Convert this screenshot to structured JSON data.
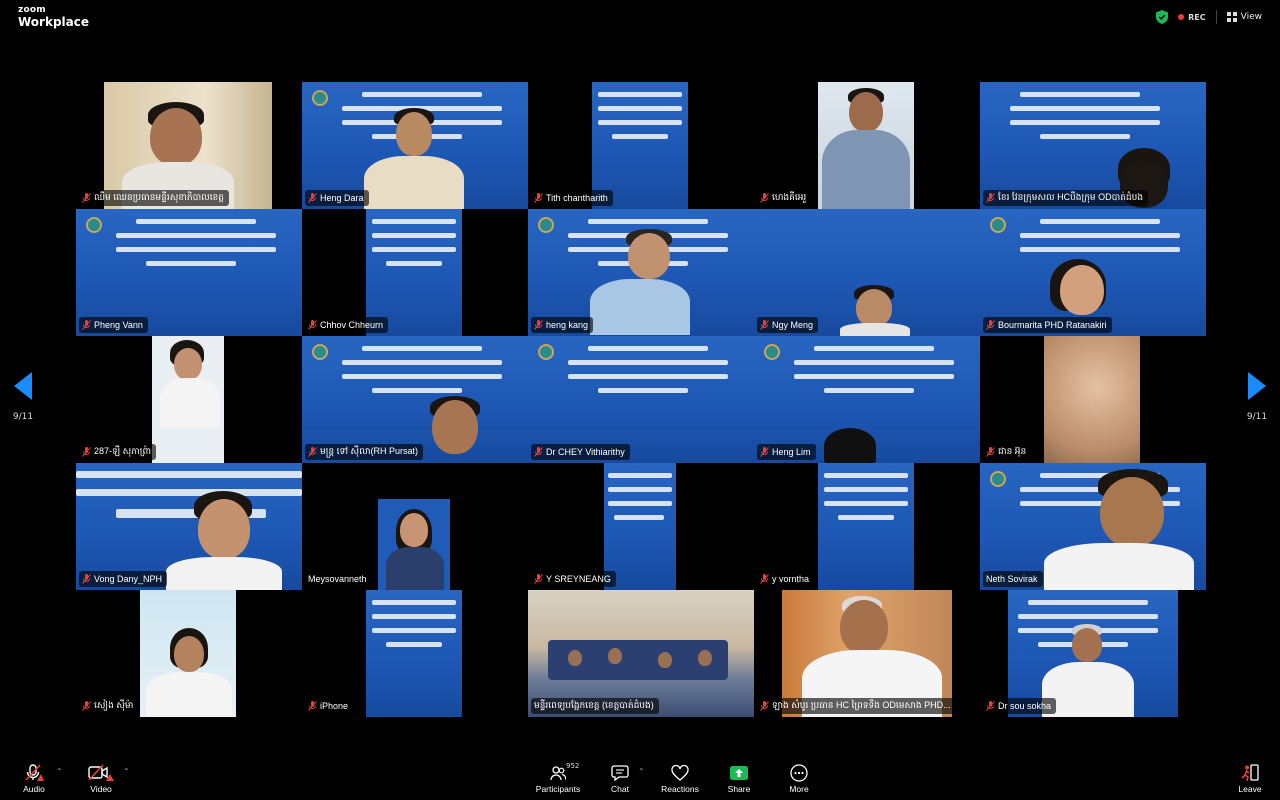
{
  "app": {
    "brand_top": "zoom",
    "brand_bottom": "Workplace"
  },
  "header": {
    "rec_label": "REC",
    "view_label": "View"
  },
  "pagination": {
    "left_label": "9/11",
    "right_label": "9/11"
  },
  "participants": [
    "ឈឹម ឈេនប្រធានមន្ទីរសុខាភិបាលខេត្ត",
    "Heng Dara",
    "Tith chantharith",
    "ហេងគីអេរួ",
    "ខែរ វែនក្រុមសល HCបឹងក្រុម ODបាត់ដំបង",
    "Pheng Vann",
    "Chhov Chheurn",
    "heng kang",
    "Ngy Meng",
    "Bourmarita PHD Ratanakiri",
    "287-ឡី សុភាព្រ៉ា",
    "មន្ត្រ ទៅ ស៊ីលា(RH Pursat)",
    "Dr CHEY Vithiarithy",
    "Heng Lim",
    "ជាន អ៊ុន",
    "Vong Dany_NPH",
    "Meysovanneth",
    "Y SREYNEANG",
    "y vorntha",
    "Neth Sovirak",
    "សៀង ស៊ីម៉ា",
    "iPhone",
    "មន្ទីរពេទ្យបង្អែកខេត្ត (ខេត្តបាត់ដំបង)",
    "ឡាង សំបូរ ប្រធាន HC ព្រៃទទឹង ODមេសាង PHD...",
    "Dr sou sokha"
  ],
  "toolbar": {
    "audio_label": "Audio",
    "video_label": "Video",
    "participants_label": "Participants",
    "participants_count": "952",
    "chat_label": "Chat",
    "reactions_label": "Reactions",
    "share_label": "Share",
    "more_label": "More",
    "leave_label": "Leave"
  },
  "colors": {
    "accent_blue": "#1a8cff",
    "slide_blue": "#1f5bb7",
    "muted_red": "#e8413b",
    "share_green": "#1db954"
  }
}
